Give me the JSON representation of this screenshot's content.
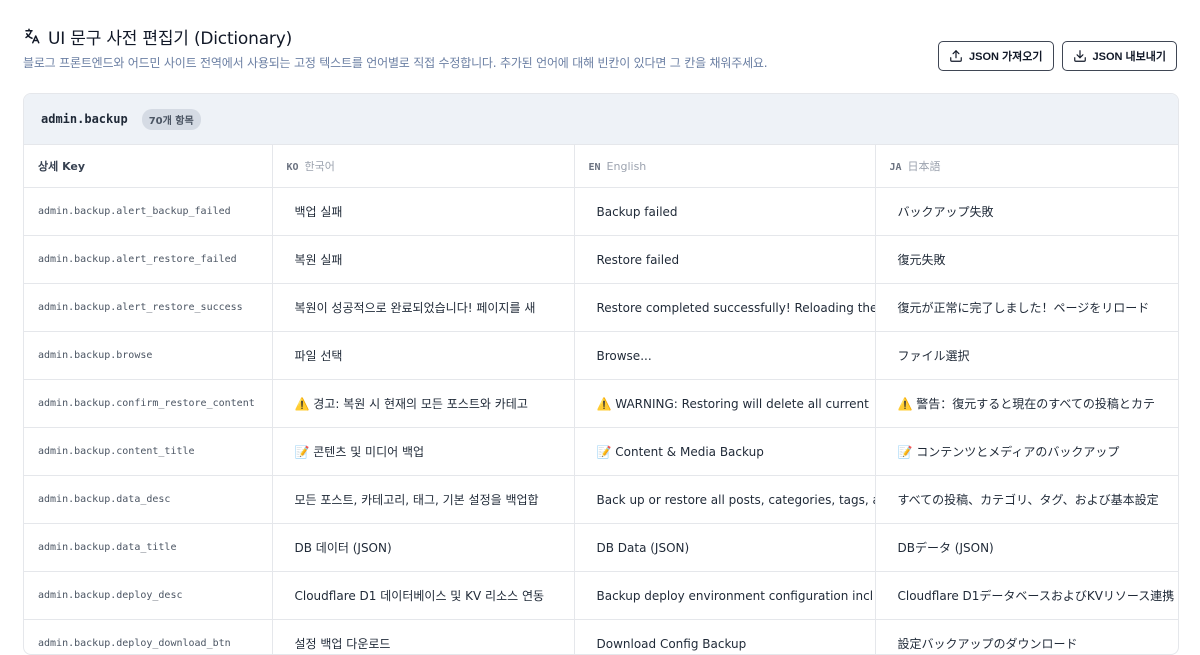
{
  "header": {
    "title": "UI 문구 사전 편집기 (Dictionary)",
    "subtitle": "블로그 프론트엔드와 어드민 사이트 전역에서 사용되는 고정 텍스트를 언어별로 직접 수정합니다. 추가된 언어에 대해 빈칸이 있다면 그 칸을 채워주세요.",
    "import_label": "JSON 가져오기",
    "export_label": "JSON 내보내기"
  },
  "group": {
    "name": "admin.backup",
    "count": "70개 항목"
  },
  "columns": {
    "key": "상세 Key",
    "ko_code": "KO",
    "ko_name": "한국어",
    "en_code": "EN",
    "en_name": "English",
    "ja_code": "JA",
    "ja_name": "日本語"
  },
  "rows": [
    {
      "key": "admin.backup.alert_backup_failed",
      "ko": "백업 실패",
      "en": "Backup failed",
      "ja": "バックアップ失敗"
    },
    {
      "key": "admin.backup.alert_restore_failed",
      "ko": "복원 실패",
      "en": "Restore failed",
      "ja": "復元失敗"
    },
    {
      "key": "admin.backup.alert_restore_success",
      "ko": "복원이 성공적으로 완료되었습니다! 페이지를 새",
      "en": "Restore completed successfully! Reloading the",
      "ja": "復元が正常に完了しました！ページをリロード"
    },
    {
      "key": "admin.backup.browse",
      "ko": "파일 선택",
      "en": "Browse...",
      "ja": "ファイル選択"
    },
    {
      "key": "admin.backup.confirm_restore_content",
      "ko": "⚠️ 경고: 복원 시 현재의 모든 포스트와 카테고",
      "en": "⚠️ WARNING: Restoring will delete all current",
      "ja": "⚠️ 警告：復元すると現在のすべての投稿とカテ"
    },
    {
      "key": "admin.backup.content_title",
      "ko": "📝 콘텐츠 및 미디어 백업",
      "en": "📝 Content & Media Backup",
      "ja": "📝 コンテンツとメディアのバックアップ"
    },
    {
      "key": "admin.backup.data_desc",
      "ko": "모든 포스트, 카테고리, 태그, 기본 설정을 백업합",
      "en": "Back up or restore all posts, categories, tags, and",
      "ja": "すべての投稿、カテゴリ、タグ、および基本設定"
    },
    {
      "key": "admin.backup.data_title",
      "ko": "DB 데이터 (JSON)",
      "en": "DB Data (JSON)",
      "ja": "DBデータ (JSON)"
    },
    {
      "key": "admin.backup.deploy_desc",
      "ko": "Cloudflare D1 데이터베이스 및 KV 리소스 연동",
      "en": "Backup deploy environment configuration incl",
      "ja": "Cloudflare D1データベースおよびKVリソース連携"
    },
    {
      "key": "admin.backup.deploy_download_btn",
      "ko": "설정 백업 다운로드",
      "en": "Download Config Backup",
      "ja": "設定バックアップのダウンロード"
    }
  ]
}
